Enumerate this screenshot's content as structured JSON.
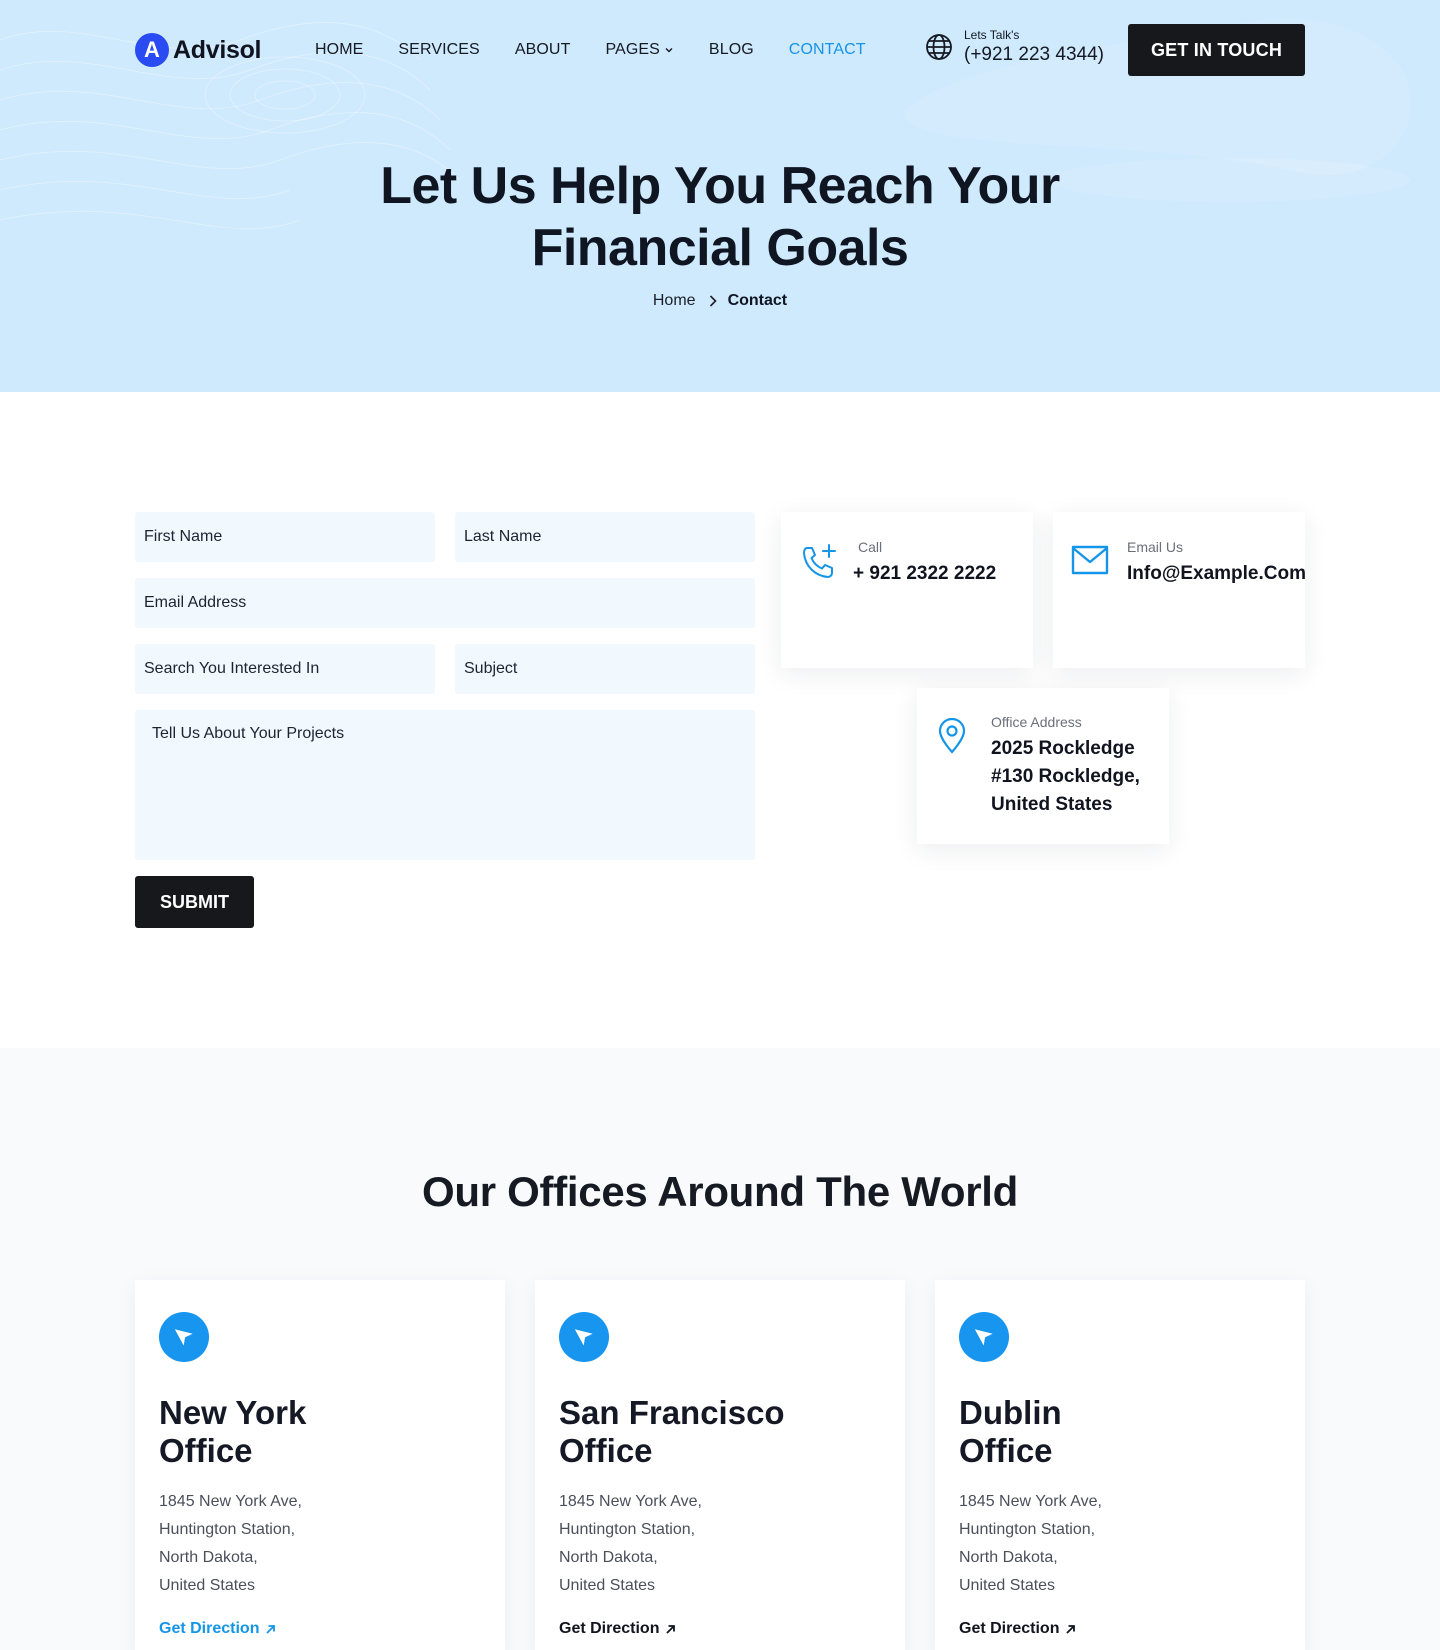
{
  "header": {
    "logo_mark": "A",
    "logo_text": "Advisol",
    "nav": [
      {
        "label": "HOME",
        "active": false
      },
      {
        "label": "SERVICES",
        "active": false
      },
      {
        "label": "ABOUT",
        "active": false
      },
      {
        "label": "PAGES",
        "active": false,
        "dropdown": true
      },
      {
        "label": "BLOG",
        "active": false
      },
      {
        "label": "CONTACT",
        "active": true
      }
    ],
    "talk_label": "Lets Talk's",
    "talk_phone": "(+921 223 4344)",
    "cta_label": "GET IN TOUCH"
  },
  "hero": {
    "title_line1": "Let Us Help You Reach Your",
    "title_line2": "Financial Goals",
    "breadcrumb": {
      "home": "Home",
      "current": "Contact"
    }
  },
  "form": {
    "first_name": "First Name",
    "last_name": "Last Name",
    "email": "Email Address",
    "interest": "Search You Interested In",
    "subject": "Subject",
    "message": "Tell Us About Your Projects",
    "submit": "SUBMIT"
  },
  "contact_info": {
    "call": {
      "label": "Call",
      "value": "+ 921 2322 2222",
      "icon": "phone-plus-icon"
    },
    "email": {
      "label": "Email Us",
      "value": "Info@Example.Com",
      "icon": "mail-icon"
    },
    "address": {
      "label": "Office Address",
      "line1": "2025 Rockledge",
      "line2": "#130 Rockledge,",
      "line3": "United States",
      "icon": "map-pin-icon"
    }
  },
  "offices": {
    "title": "Our Offices Around The World",
    "items": [
      {
        "name1": "New York",
        "name2": "Office",
        "addr": [
          "1845 New York Ave,",
          "Huntington Station,",
          "North Dakota,",
          "United States"
        ],
        "link": "Get Direction",
        "highlight": true
      },
      {
        "name1": "San Francisco",
        "name2": "Office",
        "addr": [
          "1845 New York Ave,",
          "Huntington Station,",
          "North Dakota,",
          "United States"
        ],
        "link": "Get Direction",
        "highlight": false
      },
      {
        "name1": "Dublin",
        "name2": "Office",
        "addr": [
          "1845 New York Ave,",
          "Huntington Station,",
          "North Dakota,",
          "United States"
        ],
        "link": "Get Direction",
        "highlight": false
      }
    ]
  },
  "colors": {
    "accent": "#1595e8",
    "brand": "#2b4bf2",
    "dark_button": "#17181c",
    "hero_bg": "#cfe9fd",
    "field_bg": "#f1f8fe"
  }
}
